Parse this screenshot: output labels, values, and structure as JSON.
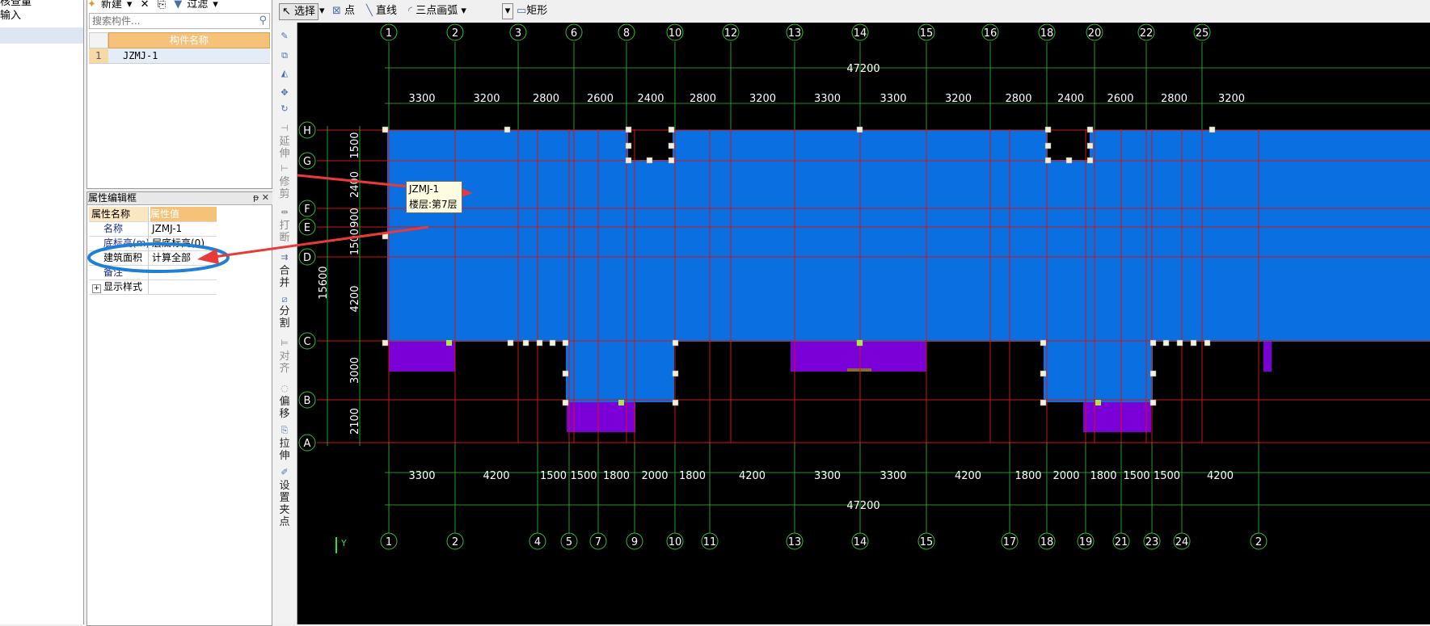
{
  "left_nav": {
    "items": [
      {
        "label": "核查量",
        "selected": false
      },
      {
        "label": "输入",
        "selected": false
      },
      {
        "label": "",
        "selected": true
      }
    ]
  },
  "component_list": {
    "toolbar": {
      "new_label": "新建",
      "delete_label": "✕",
      "copy_label": "⎘",
      "filter_label": "过滤"
    },
    "search": {
      "placeholder": "搜索构件..."
    },
    "column_header": "构件名称",
    "rows": [
      {
        "index": "1",
        "name": "JZMJ-1"
      }
    ]
  },
  "property_editor": {
    "title": "属性编辑框",
    "pin_label": "ᵽ",
    "close_label": "✕",
    "col_name": "属性名称",
    "col_value": "属性值",
    "rows": [
      {
        "name": "名称",
        "value": "JZMJ-1"
      },
      {
        "name": "底标高(m)",
        "value": "层底标高(0)"
      },
      {
        "name": "建筑面积",
        "value": "计算全部"
      },
      {
        "name": "备注",
        "value": ""
      },
      {
        "name": "显示样式",
        "value": "",
        "expander": "+"
      }
    ]
  },
  "draw_toolbar": {
    "select_label": "选择",
    "point_label": "点",
    "line_label": "直线",
    "arc_label": "三点画弧",
    "rect_label": "矩形"
  },
  "modify_toolbar": {
    "extend_label": "延伸",
    "trim_label": "修剪",
    "break_label": "打断",
    "merge_label": "合并",
    "split_label": "分割",
    "align_label": "对齐",
    "offset_label": "偏移",
    "stretch_label": "拉伸",
    "grip_label": "设置夹点"
  },
  "tooltip": {
    "line1": "JZMJ-1",
    "line2": "楼层:第7层"
  },
  "cad": {
    "top_axes": [
      "1",
      "2",
      "3",
      "6",
      "8",
      "10",
      "12",
      "13",
      "14",
      "15",
      "16",
      "18",
      "20",
      "22",
      "25"
    ],
    "bottom_axes": [
      "1",
      "2",
      "4",
      "5",
      "7",
      "9",
      "10",
      "11",
      "13",
      "14",
      "15",
      "17",
      "18",
      "19",
      "21",
      "23",
      "24",
      "2"
    ],
    "row_axes": [
      "H",
      "G",
      "F",
      "E",
      "D",
      "C",
      "B",
      "A"
    ],
    "top_total": "47200",
    "bottom_total": "47200",
    "top_dims": [
      "3300",
      "3200",
      "2800",
      "2600",
      "2400",
      "2800",
      "3200",
      "3300",
      "3300",
      "3200",
      "2800",
      "2400",
      "2600",
      "2800",
      "3200"
    ],
    "bottom_dims": [
      "3300",
      "4200",
      "1500",
      "1500",
      "1800",
      "2000",
      "1800",
      "4200",
      "3300",
      "3300",
      "4200",
      "1800",
      "2000",
      "1800",
      "1500",
      "1500",
      "4200"
    ],
    "left_dims": [
      "1500",
      "2400",
      "900",
      "1500",
      "4200",
      "3000",
      "2100"
    ],
    "left_total": "15600",
    "ucs_label": "Y",
    "colors": {
      "background": "#000000",
      "area_fill": "#0a6fe0",
      "balcony_fill": "#7b00d8",
      "axis_line": "#d11414",
      "axis_bubble": "#2fc22f",
      "annotation": "#1f7fd6",
      "arrow": "#e83a3a"
    }
  }
}
